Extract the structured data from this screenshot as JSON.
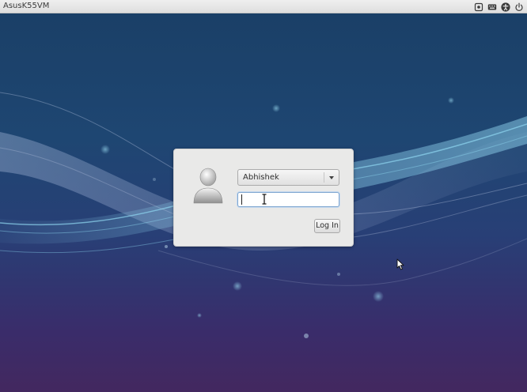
{
  "topbar": {
    "hostname": "AsusK55VM",
    "indicators": [
      {
        "icon": "session-icon"
      },
      {
        "icon": "keyboard-layout-icon"
      },
      {
        "icon": "accessibility-icon"
      },
      {
        "icon": "power-icon"
      }
    ]
  },
  "login": {
    "user_select": {
      "selected": "Abhishek"
    },
    "password_field": {
      "value": "",
      "placeholder": ""
    },
    "login_button_label": "Log In"
  },
  "colors": {
    "desktop_top": "#1a3f66",
    "desktop_bottom": "#43285f",
    "dialog_bg": "#e9e9e8",
    "focus_ring": "#7fa6d0",
    "wave_highlight": "#6fc3e3"
  }
}
